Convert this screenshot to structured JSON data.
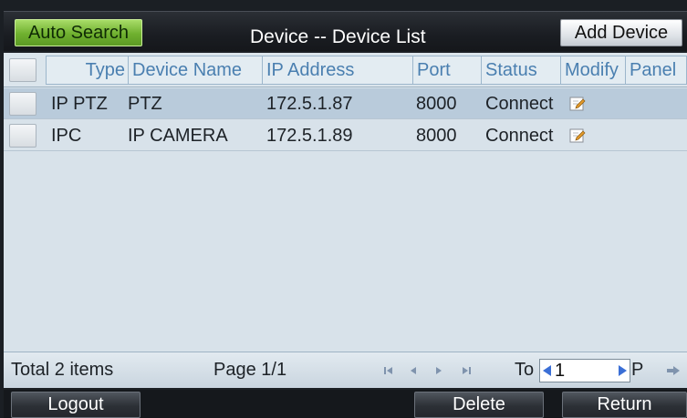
{
  "header": {
    "auto_search_label": "Auto Search",
    "title": "Device -- Device List",
    "add_device_label": "Add Device"
  },
  "table": {
    "columns": [
      "Type",
      "Device Name",
      "IP Address",
      "Port",
      "Status",
      "Modify",
      "Panel"
    ],
    "rows": [
      {
        "type": "IP PTZ",
        "device_name": "PTZ",
        "ip": "172.5.1.87",
        "port": "8000",
        "status": "Connect",
        "selected": true
      },
      {
        "type": "IPC",
        "device_name": "IP CAMERA",
        "ip": "172.5.1.89",
        "port": "8000",
        "status": "Connect",
        "selected": false
      }
    ]
  },
  "pager": {
    "total": "Total 2 items",
    "page": "Page 1/1",
    "to_label": "To",
    "page_value": "1",
    "p_label": "P"
  },
  "footer": {
    "logout_label": "Logout",
    "delete_label": "Delete",
    "return_label": "Return"
  },
  "colors": {
    "accent_green": "#6fb02f",
    "header_text_blue": "#4a7fb0",
    "selected_row": "#b9cbdb",
    "nav_arrow_blue": "#3b6fd6"
  },
  "icons": {
    "modify": "edit-pencil-icon",
    "first": "first-page-icon",
    "prev": "prev-page-icon",
    "next": "next-page-icon",
    "last": "last-page-icon",
    "go": "go-arrow-icon"
  }
}
